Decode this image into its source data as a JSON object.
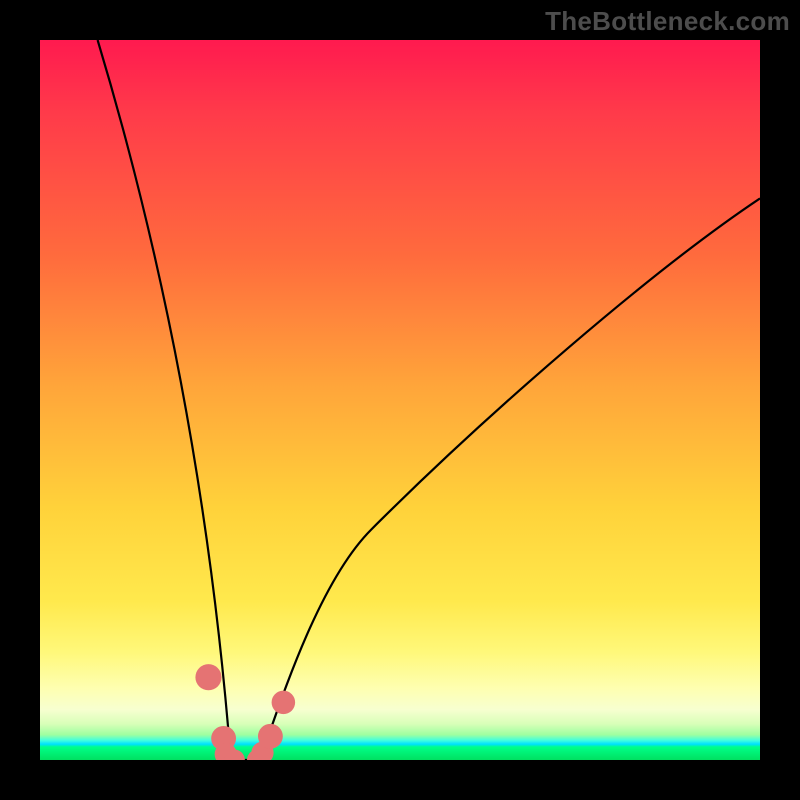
{
  "watermark": {
    "text": "TheBottleneck.com"
  },
  "colors": {
    "frame_bg": "#000000",
    "curve_stroke": "#000000",
    "marker_fill": "#e57373",
    "marker_stroke": "#c45a5a"
  },
  "chart_data": {
    "type": "line",
    "title": "",
    "xlabel": "",
    "ylabel": "",
    "xlim": [
      0,
      100
    ],
    "ylim": [
      0,
      100
    ],
    "grid": false,
    "legend": false,
    "series": [
      {
        "name": "bottleneck-v-curve",
        "curve": {
          "left_branch": {
            "x_top": 8,
            "y_top": 100,
            "x_bottom": 26.5,
            "y_bottom": 0
          },
          "right_branch": {
            "x_bottom": 30.5,
            "y_bottom": 0,
            "x_top": 100,
            "y_top": 78
          },
          "floor": {
            "x0": 26.5,
            "x1": 30.5,
            "y": 0
          }
        }
      }
    ],
    "markers": [
      {
        "x": 23.4,
        "y": 11.5,
        "r": 1.4
      },
      {
        "x": 25.5,
        "y": 3.0,
        "r": 1.3
      },
      {
        "x": 25.8,
        "y": 0.8,
        "r": 1.1
      },
      {
        "x": 27.0,
        "y": 0.0,
        "r": 1.0
      },
      {
        "x": 30.2,
        "y": 0.0,
        "r": 1.0
      },
      {
        "x": 30.9,
        "y": 1.0,
        "r": 1.1
      },
      {
        "x": 32.0,
        "y": 3.3,
        "r": 1.3
      },
      {
        "x": 33.8,
        "y": 8.0,
        "r": 1.2
      }
    ]
  }
}
